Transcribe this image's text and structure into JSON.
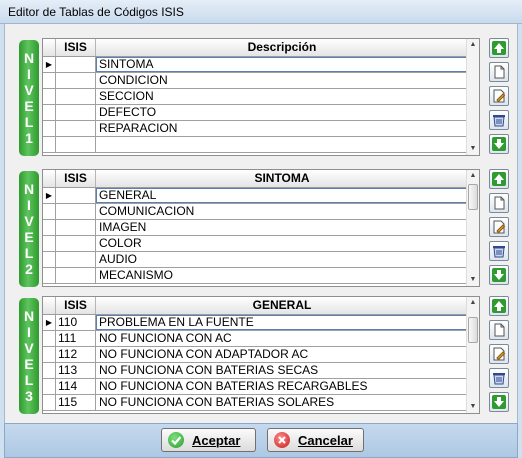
{
  "window": {
    "title": "Editor de Tablas de Códigos ISIS"
  },
  "levels": [
    {
      "tab_letters": [
        "N",
        "I",
        "V",
        "E",
        "L",
        "1"
      ],
      "columns": [
        "ISIS",
        "Descripción"
      ],
      "rows": [
        {
          "marker": "▶",
          "code": "",
          "desc": "SINTOMA"
        },
        {
          "marker": "",
          "code": "",
          "desc": "CONDICION"
        },
        {
          "marker": "",
          "code": "",
          "desc": "SECCION"
        },
        {
          "marker": "",
          "code": "",
          "desc": "DEFECTO"
        },
        {
          "marker": "",
          "code": "",
          "desc": "REPARACION"
        },
        {
          "marker": "",
          "code": "",
          "desc": ""
        }
      ]
    },
    {
      "tab_letters": [
        "N",
        "I",
        "V",
        "E",
        "L",
        "2"
      ],
      "columns": [
        "ISIS",
        "SINTOMA"
      ],
      "rows": [
        {
          "marker": "▶",
          "code": "",
          "desc": "GENERAL"
        },
        {
          "marker": "",
          "code": "",
          "desc": "COMUNICACION"
        },
        {
          "marker": "",
          "code": "",
          "desc": "IMAGEN"
        },
        {
          "marker": "",
          "code": "",
          "desc": "COLOR"
        },
        {
          "marker": "",
          "code": "",
          "desc": "AUDIO"
        },
        {
          "marker": "",
          "code": "",
          "desc": "MECANISMO"
        }
      ]
    },
    {
      "tab_letters": [
        "N",
        "I",
        "V",
        "E",
        "L",
        "3"
      ],
      "columns": [
        "ISIS",
        "GENERAL"
      ],
      "rows": [
        {
          "marker": "▶",
          "code": "110",
          "desc": "PROBLEMA EN LA FUENTE"
        },
        {
          "marker": "",
          "code": "111",
          "desc": "NO FUNCIONA CON AC"
        },
        {
          "marker": "",
          "code": "112",
          "desc": "NO FUNCIONA CON ADAPTADOR AC"
        },
        {
          "marker": "",
          "code": "113",
          "desc": "NO FUNCIONA CON BATERIAS SECAS"
        },
        {
          "marker": "",
          "code": "114",
          "desc": "NO FUNCIONA CON BATERIAS RECARGABLES"
        },
        {
          "marker": "",
          "code": "115",
          "desc": "NO FUNCIONA CON BATERIAS SOLARES"
        }
      ]
    }
  ],
  "side_buttons": [
    "arrow-up-icon",
    "new-record-icon",
    "edit-record-icon",
    "delete-record-icon",
    "arrow-down-icon"
  ],
  "colors": {
    "accent_green": "#2f9a2f",
    "footer_blue": "#b7cfe8",
    "ok_green": "#2e9e2e",
    "cancel_red": "#d42a2a"
  },
  "footer": {
    "accept_label": "Aceptar",
    "cancel_label": "Cancelar"
  }
}
